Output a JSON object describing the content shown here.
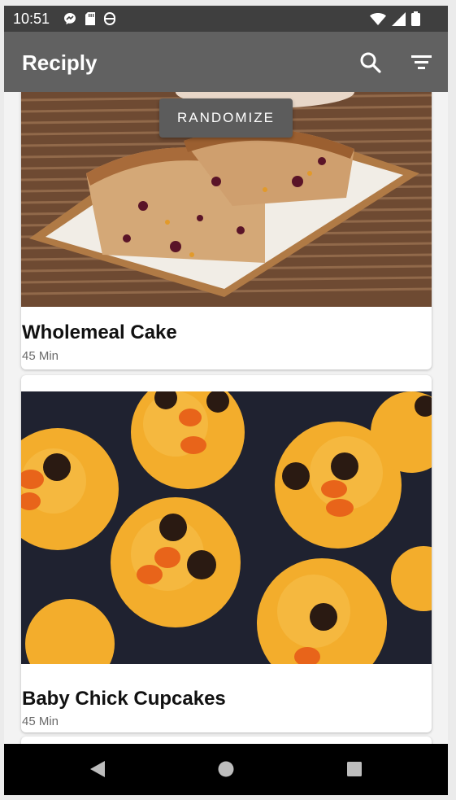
{
  "status_bar": {
    "time": "10:51",
    "left_icons": [
      "messenger-icon",
      "sd-card-icon",
      "data-saver-icon"
    ],
    "right_icons": [
      "wifi-icon",
      "signal-icon",
      "battery-icon"
    ]
  },
  "app_bar": {
    "title": "Reciply",
    "actions": [
      "search-icon",
      "filter-icon"
    ]
  },
  "randomize_label": "RANDOMIZE",
  "recipes": [
    {
      "title": "Wholemeal Cake",
      "time": "45 Min",
      "image": "cake-slices-photo"
    },
    {
      "title": "Baby Chick Cupcakes",
      "time": "45 Min",
      "image": "chick-cupcakes-photo"
    }
  ],
  "nav_bar": {
    "buttons": [
      "back-icon",
      "home-icon",
      "recents-icon"
    ]
  },
  "colors": {
    "status_bar": "#3f3f3f",
    "app_bar": "#616161",
    "button": "#5c5c5c",
    "nav_bar": "#000000"
  }
}
